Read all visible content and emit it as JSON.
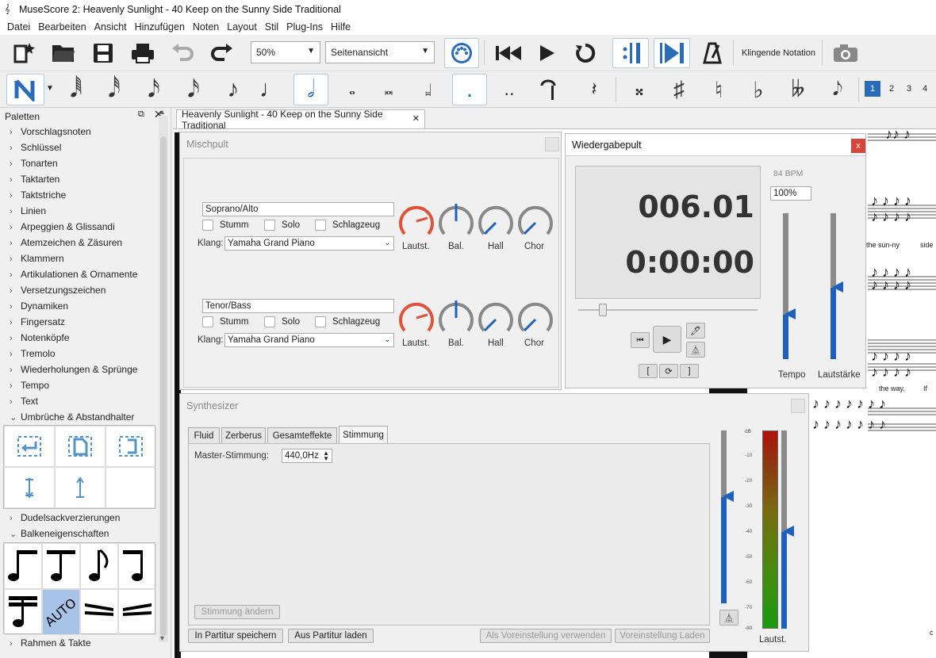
{
  "window": {
    "title": "MuseScore 2: Heavenly Sunlight - 40 Keep on the Sunny Side Traditional"
  },
  "menu": [
    "Datei",
    "Bearbeiten",
    "Ansicht",
    "Hinzufügen",
    "Noten",
    "Layout",
    "Stil",
    "Plug-Ins",
    "Hilfe"
  ],
  "toolbar": {
    "zoom_value": "50%",
    "view_mode": "Seitenansicht",
    "concert_pitch_label": "Klingende Notation"
  },
  "note_input": {
    "voices": [
      "1",
      "2",
      "3",
      "4"
    ]
  },
  "palettes": {
    "title": "Paletten",
    "items": [
      "Vorschlagsnoten",
      "Schlüssel",
      "Tonarten",
      "Taktarten",
      "Taktstriche",
      "Linien",
      "Arpeggien & Glissandi",
      "Atemzeichen & Zäsuren",
      "Klammern",
      "Artikulationen & Ornamente",
      "Versetzungszeichen",
      "Dynamiken",
      "Fingersatz",
      "Notenköpfe",
      "Tremolo",
      "Wiederholungen & Sprünge",
      "Tempo",
      "Text",
      "Umbrüche & Abstandhalter"
    ],
    "items_after": [
      "Dudelsackverzierungen",
      "Balkeneigenschaften"
    ],
    "items_bottom": [
      "Rahmen & Takte"
    ],
    "auto_label": "AUTO"
  },
  "score_tab": {
    "label": "Heavenly Sunlight - 40 Keep on the Sunny Side Traditional"
  },
  "score_lyrics": {
    "l1": "the sun-ny",
    "l2": "side",
    "l3": "the way,",
    "l4": "If",
    "l5": "c"
  },
  "mixer": {
    "title": "Mischpult",
    "channels": [
      {
        "name": "Soprano/Alto",
        "mute": "Stumm",
        "solo": "Solo",
        "drums": "Schlagzeug",
        "sound_label": "Klang:",
        "sound": "Yamaha Grand Piano"
      },
      {
        "name": "Tenor/Bass",
        "mute": "Stumm",
        "solo": "Solo",
        "drums": "Schlagzeug",
        "sound_label": "Klang:",
        "sound": "Yamaha Grand Piano"
      }
    ],
    "knob_labels": [
      "Lautst.",
      "Bal.",
      "Hall",
      "Chor"
    ],
    "colors": {
      "volume": "#e0533a",
      "other": "#1f5fbf"
    }
  },
  "playback": {
    "title": "Wiedergabepult",
    "close": "x",
    "measure_beat": "006.01",
    "time": "0:00:00",
    "bpm": "84 BPM",
    "tempo_percent": "100%",
    "tempo_label": "Tempo",
    "volume_label": "Lautstärke",
    "loop_in": "[",
    "loop_out": "]"
  },
  "synth": {
    "title": "Synthesizer",
    "tabs": [
      "Fluid",
      "Zerberus",
      "Gesamteffekte",
      "Stimmung"
    ],
    "active_tab": "Stimmung",
    "tuning_label": "Master-Stimmung:",
    "tuning_value": "440,0Hz",
    "change_tuning": "Stimmung ändern",
    "save_to_score": "In Partitur speichern",
    "load_from_score": "Aus Partitur laden",
    "use_as_default": "Als Voreinstellung verwenden",
    "load_default": "Voreinstellung Laden",
    "meter_label": "Lautst.",
    "db_ticks": [
      "dB",
      "-10",
      "-20",
      "-30",
      "-40",
      "-50",
      "-60",
      "-70",
      "-80"
    ]
  }
}
